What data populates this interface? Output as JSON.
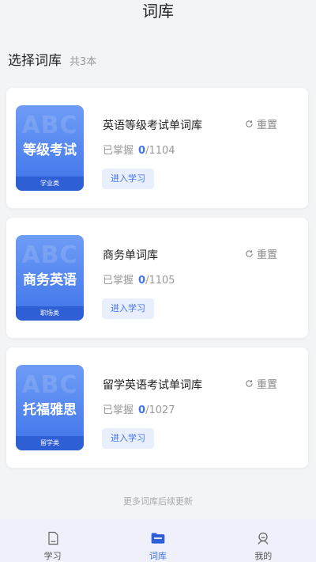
{
  "header": {
    "title": "词库"
  },
  "section": {
    "title": "选择词库",
    "count": "共3本"
  },
  "cards": [
    {
      "cover_watermark": "ABC",
      "cover_title": "等级考试",
      "cover_category": "学业类",
      "name": "英语等级考试单词库",
      "reset_label": "重置",
      "mastered_label": "已掌握",
      "mastered_count": "0",
      "total": "/1104",
      "button_label": "进入学习"
    },
    {
      "cover_watermark": "ABC",
      "cover_title": "商务英语",
      "cover_category": "职场类",
      "name": "商务单词库",
      "reset_label": "重置",
      "mastered_label": "已掌握",
      "mastered_count": "0",
      "total": "/1105",
      "button_label": "进入学习"
    },
    {
      "cover_watermark": "ABC",
      "cover_title": "托福雅思",
      "cover_category": "留学类",
      "name": "留学英语考试单词库",
      "reset_label": "重置",
      "mastered_label": "已掌握",
      "mastered_count": "0",
      "total": "/1027",
      "button_label": "进入学习"
    }
  ],
  "footer_note": "更多词库后续更新",
  "tabs": [
    {
      "label": "学习",
      "icon": "study-icon",
      "active": false
    },
    {
      "label": "词库",
      "icon": "folder-icon",
      "active": true
    },
    {
      "label": "我的",
      "icon": "profile-icon",
      "active": false
    }
  ],
  "colors": {
    "accent": "#3f74ea",
    "background": "#f3f4f6"
  }
}
